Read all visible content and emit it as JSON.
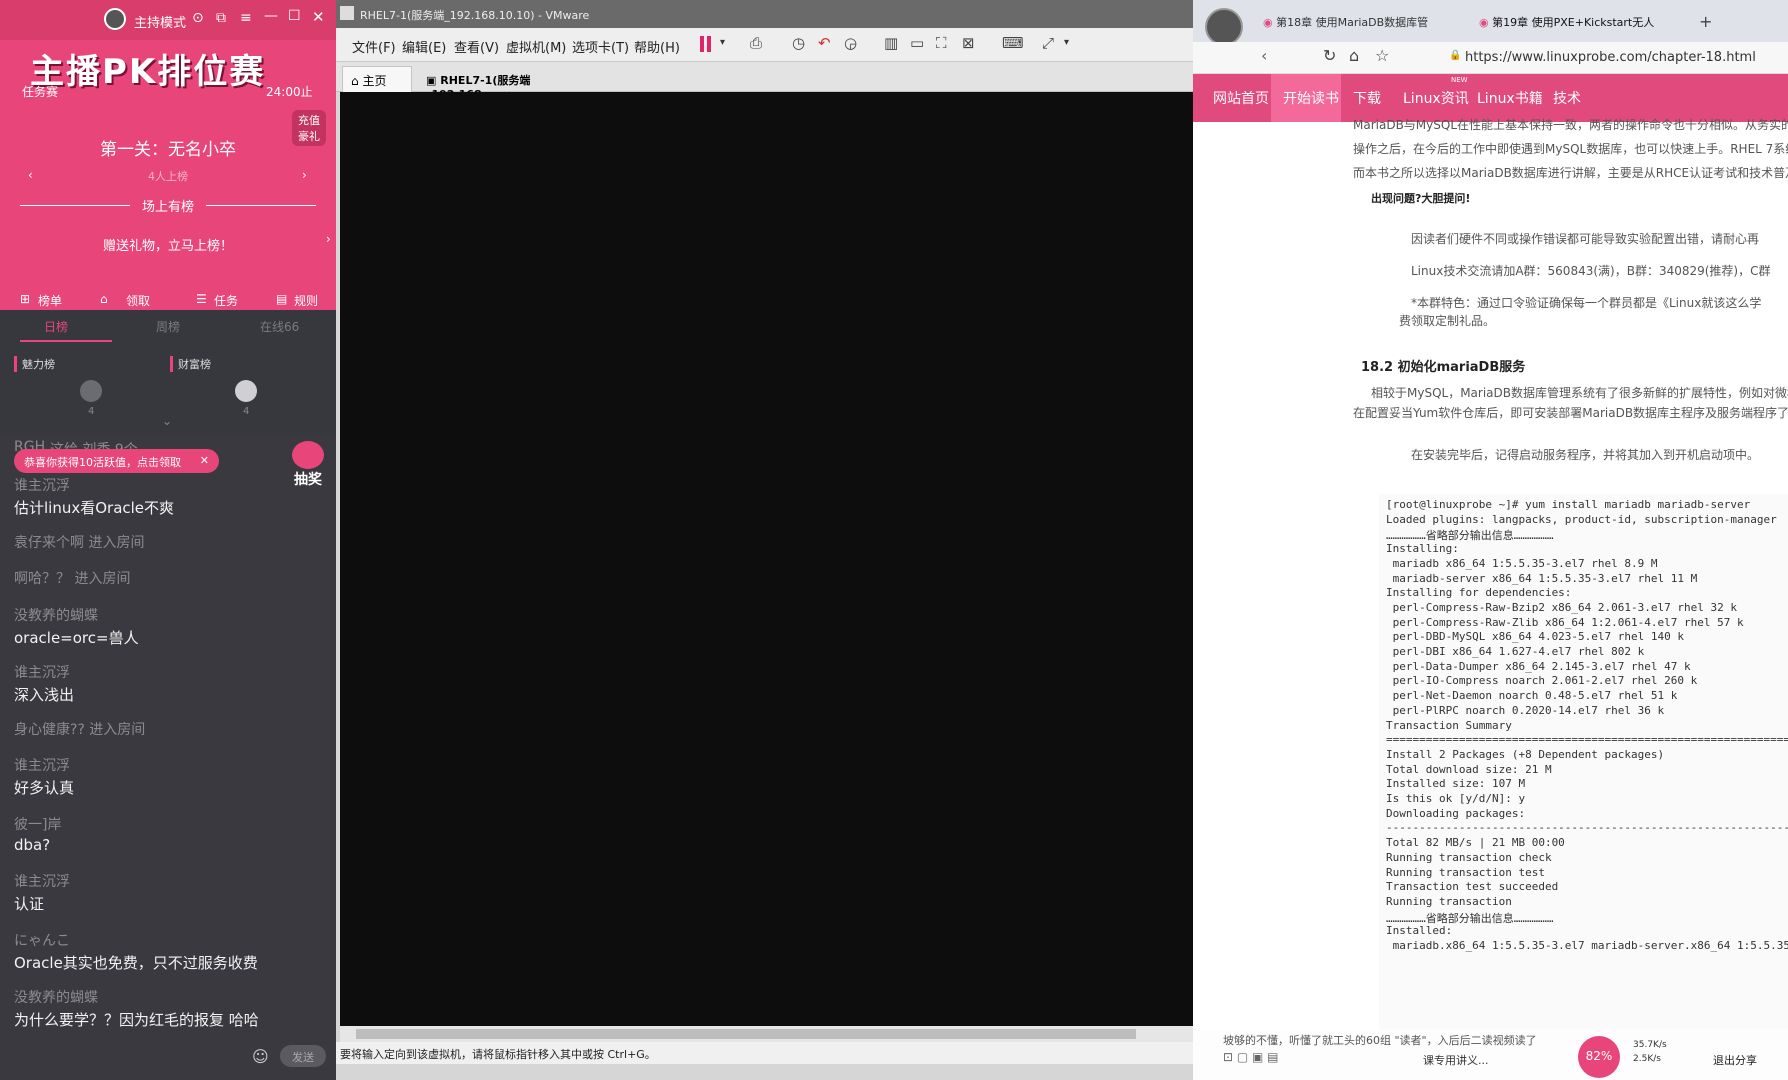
{
  "left": {
    "mode_label": "主持模式",
    "banner": "主播PK排位赛",
    "task_label": "任务赛",
    "deadline": "24:00止",
    "recharge": "充值豪礼",
    "level_title": "第一关：无名小卒",
    "level_sub": "4人上榜",
    "on_list": "场上有榜",
    "gift_cta": "赠送礼物，立马上榜！",
    "bottom_tabs": [
      "榜单",
      "领取",
      "任务",
      "规则"
    ],
    "rank_tabs": [
      "日榜",
      "周榜",
      "在线66"
    ],
    "charm_label": "魅力榜",
    "wealth_label": "财富榜",
    "rank_counts": [
      "4",
      "4"
    ],
    "toast": "恭喜你获得10活跃值，点击领取",
    "lottery": "抽奖",
    "emoji_btn": "发送",
    "chat": [
      {
        "nick": "RGH",
        "msg": "这给 刘秀 9个",
        "partial": true
      },
      {
        "nick": "谁主沉浮",
        "msg": "估计linux看Oracle不爽"
      },
      {
        "nick": "",
        "msg": "袁仔来个啊 进入房间",
        "system": true
      },
      {
        "nick": "",
        "msg": "啊哈？？ 进入房间",
        "system": true
      },
      {
        "nick": "没教养的蝴蝶",
        "msg": "oracle=orc=兽人"
      },
      {
        "nick": "谁主沉浮",
        "msg": "深入浅出"
      },
      {
        "nick": "",
        "msg": "身心健康?? 进入房间",
        "system": true
      },
      {
        "nick": "谁主沉浮",
        "msg": "好多认真"
      },
      {
        "nick": "彼一]岸",
        "msg": "dba?"
      },
      {
        "nick": "谁主沉浮",
        "msg": "认证"
      },
      {
        "nick": "にゃんこ",
        "msg": "Oracle其实也免费，只不过服务收费"
      },
      {
        "nick": "没教养的蝴蝶",
        "msg": "为什么要学？？因为红毛的报复 哈哈"
      }
    ]
  },
  "vm": {
    "title": "RHEL7-1(服务端_192.168.10.10) - VMware",
    "menus": [
      "文件(F)",
      "编辑(E)",
      "查看(V)",
      "虚拟机(M)",
      "选项卡(T)",
      "帮助(H)"
    ],
    "tabs": [
      "主页",
      "RHEL7-1(服务端_192.168...."
    ],
    "status": "要将输入定向到该虚拟机，请将鼠标指针移入其中或按 Ctrl+G。"
  },
  "browser": {
    "tabs": [
      "第18章 使用MariaDB数据库管",
      "第19章 使用PXE+Kickstart无人"
    ],
    "url": "https://www.linuxprobe.com/chapter-18.html",
    "nav": [
      "网站首页",
      "开始读书",
      "下载",
      "Linux资讯",
      "Linux书籍",
      "技术"
    ],
    "nav_badge": "NEW",
    "intro_lines": [
      "MariaDB与MySQL在性能上基本保持一致，两者的操作命令也十分相似。从务实的角度来讲",
      "操作之后，在今后的工作中即使遇到MySQL数据库，也可以快速上手。RHEL 7系统",
      "而本书之所以选择以MariaDB数据库进行讲解，主要是从RHCE认证考试和技术普及的角度"
    ],
    "question_title": "出现问题?大胆提问!",
    "question_lines": [
      "因读者们硬件不同或操作错误都可能导致实验配置出错，请耐心再",
      "Linux技术交流请加A群：560843(满)，B群：340829(推荐)，C群",
      "*本群特色：通过口令验证确保每一个群员都是《Linux就该这么学",
      "费领取定制礼品。"
    ],
    "section_title": "18.2 初始化mariaDB服务",
    "section_lines": [
      "相较于MySQL，MariaDB数据库管理系统有了很多新鲜的扩展特性，例如对微秒",
      "在配置妥当Yum软件仓库后，即可安装部署MariaDB数据库主程序及服务端程序了。",
      "在安装完毕后，记得启动服务程序，并将其加入到开机启动项中。"
    ],
    "code_lines": [
      "[root@linuxprobe ~]# yum install mariadb mariadb-server",
      "Loaded plugins: langpacks, product-id, subscription-manager",
      "………………省略部分输出信息………………",
      "Installing:",
      " mariadb x86_64 1:5.5.35-3.el7 rhel 8.9 M",
      " mariadb-server x86_64 1:5.5.35-3.el7 rhel 11 M",
      "Installing for dependencies:",
      " perl-Compress-Raw-Bzip2 x86_64 2.061-3.el7 rhel 32 k",
      " perl-Compress-Raw-Zlib x86_64 1:2.061-4.el7 rhel 57 k",
      " perl-DBD-MySQL x86_64 4.023-5.el7 rhel 140 k",
      " perl-DBI x86_64 1.627-4.el7 rhel 802 k",
      " perl-Data-Dumper x86_64 2.145-3.el7 rhel 47 k",
      " perl-IO-Compress noarch 2.061-2.el7 rhel 260 k",
      " perl-Net-Daemon noarch 0.48-5.el7 rhel 51 k",
      " perl-PlRPC noarch 0.2020-14.el7 rhel 36 k",
      "Transaction Summary",
      "================================================================",
      "Install 2 Packages (+8 Dependent packages)",
      "Total download size: 21 M",
      "Installed size: 107 M",
      "Is this ok [y/d/N]: y",
      "Downloading packages:",
      "----------------------------------------------------------------",
      "Total 82 MB/s | 21 MB 00:00",
      "Running transaction check",
      "Running transaction test",
      "Transaction test succeeded",
      "Running transaction",
      "………………省略部分输出信息………………",
      "Installed:",
      " mariadb.x86_64 1:5.5.35-3.el7 mariadb-server.x86_64 1:5.5.35"
    ],
    "bottom_ticker": "坡够的不懂，听懂了就工头的60组 \"读者\"，入后后二读视频读了",
    "cpu_pct": "82%",
    "net_up": "35.7K/s",
    "net_down": "2.5K/s",
    "share_exit": "退出分享",
    "share_tip": "课专用讲义..."
  },
  "colors": {
    "accent": "#e8467a",
    "nav": "#e04a7c",
    "vm_screen": "#0d0d0d"
  }
}
